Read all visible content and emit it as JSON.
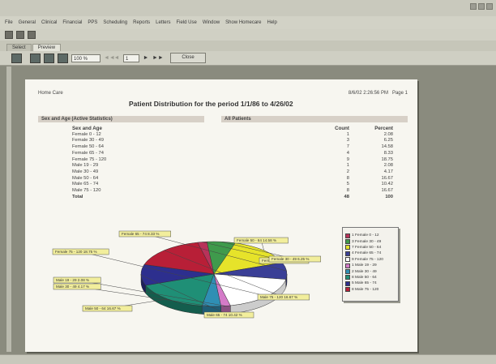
{
  "window": {
    "menu": [
      "File",
      "General",
      "Clinical",
      "Financial",
      "PPS",
      "Scheduling",
      "Reports",
      "Letters",
      "Field Use",
      "Window",
      "Show Homecare",
      "Help"
    ]
  },
  "tabs": [
    "Select",
    "Preview"
  ],
  "toolbar": {
    "zoom_value": "100 %",
    "page_value": "1",
    "close_label": "Close",
    "nav": [
      "◄◄",
      "◄",
      "►",
      "►►"
    ]
  },
  "report": {
    "org": "Home Care",
    "timestamp": "8/6/02 2:26:56 PM",
    "page_label": "Page 1",
    "title": "Patient Distribution for the period 1/1/86 to 4/26/02",
    "band_left": "Sex and Age (Active Statistics)",
    "band_right": "All Patients",
    "col_headers": {
      "group": "Sex and Age",
      "count": "Count",
      "percent": "Percent"
    },
    "rows": [
      {
        "group": "Female 0 - 12",
        "count": "1",
        "percent": "2.08"
      },
      {
        "group": "Female 30 - 49",
        "count": "3",
        "percent": "6.25"
      },
      {
        "group": "Female 50 - 64",
        "count": "7",
        "percent": "14.58"
      },
      {
        "group": "Female 65 - 74",
        "count": "4",
        "percent": "8.33"
      },
      {
        "group": "Female 75 - 120",
        "count": "9",
        "percent": "18.75"
      },
      {
        "group": "Male 19 - 29",
        "count": "1",
        "percent": "2.08"
      },
      {
        "group": "Male 30 - 49",
        "count": "2",
        "percent": "4.17"
      },
      {
        "group": "Male 50 - 64",
        "count": "8",
        "percent": "16.67"
      },
      {
        "group": "Male 65 - 74",
        "count": "5",
        "percent": "10.42"
      },
      {
        "group": "Male 75 - 120",
        "count": "8",
        "percent": "16.67"
      }
    ],
    "total": {
      "group": "Total",
      "count": "48",
      "percent": "100"
    }
  },
  "chart_data": {
    "type": "pie",
    "categories": [
      "Female 0 - 12",
      "Female 30 - 49",
      "Female 50 - 64",
      "Female 65 - 74",
      "Female 75 - 120",
      "Male 19 - 29",
      "Male 30 - 49",
      "Male 50 - 64",
      "Male 65 - 74",
      "Male 75 - 120"
    ],
    "values": [
      2.08,
      6.25,
      14.58,
      8.33,
      18.75,
      2.08,
      4.17,
      16.67,
      10.42,
      16.67
    ],
    "counts": [
      1,
      3,
      7,
      4,
      9,
      1,
      2,
      8,
      5,
      8
    ],
    "colors": [
      "#b8325a",
      "#3f9a4c",
      "#e6e32a",
      "#3a3f96",
      "#ffffff",
      "#d47bc8",
      "#2f8fb4",
      "#1f8f76",
      "#2d2f8e",
      "#b81f37"
    ],
    "slice_labels": [
      "Female 0 - 12 2.08 %",
      "Female 30 - 49 6.25 %",
      "Female 50 - 64 14.58 %",
      "Female 65 - 74 8.33 %",
      "Female 75 - 120 18.75 %",
      "Male 19 - 29 2.08 %",
      "Male 30 - 49 4.17 %",
      "Male 50 - 64 16.67 %",
      "Male 65 - 74 10.42 %",
      "Male 75 - 120 16.67 %"
    ],
    "legend_entries": [
      "1 Female 0 - 12",
      "3 Female 30 - 49",
      "7 Female 50 - 64",
      "4 Female 65 - 74",
      "9 Female 75 - 120",
      "1 Male 19 - 29",
      "2 Male 30 - 49",
      "8 Male 50 - 64",
      "5 Male 65 - 74",
      "8 Male 75 - 120"
    ],
    "legend_position": "right"
  }
}
